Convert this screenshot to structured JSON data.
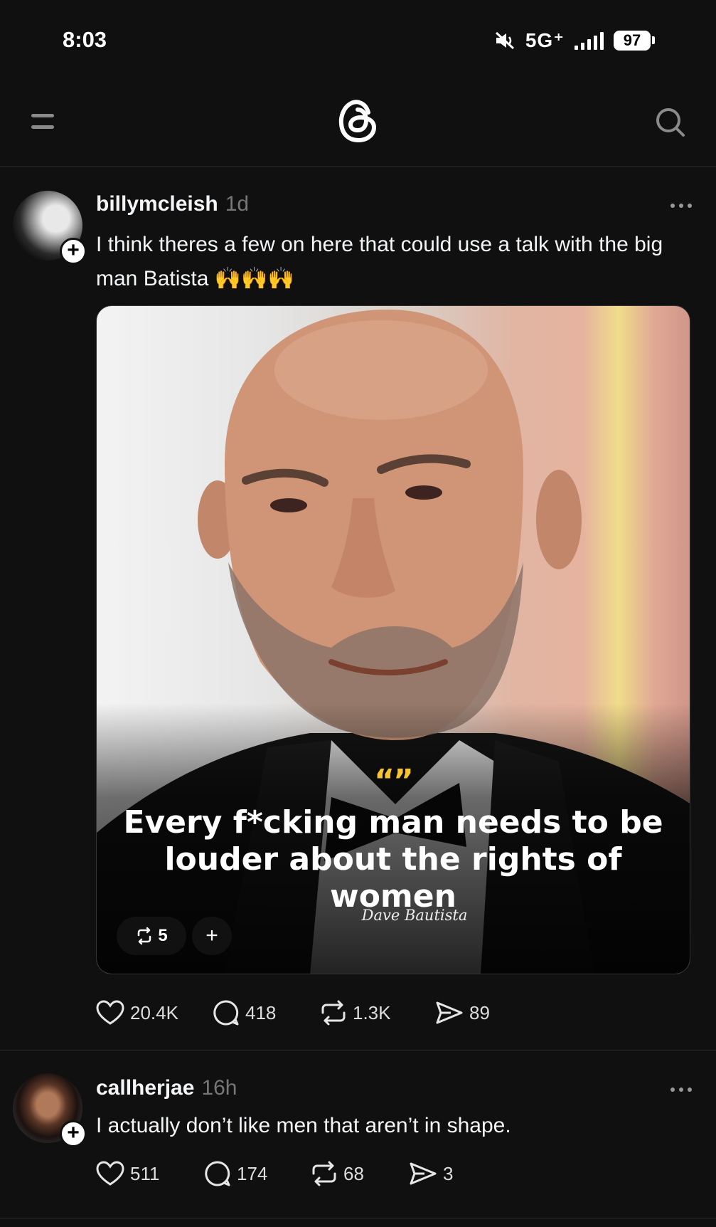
{
  "status_bar": {
    "time": "8:03",
    "network": "5G⁺",
    "battery": "97",
    "icons": [
      "mute-icon",
      "signal-icon",
      "battery-icon"
    ]
  },
  "top_nav": {
    "icons": [
      "menu-icon",
      "threads-logo-icon",
      "search-icon"
    ]
  },
  "posts": [
    {
      "username": "billymcleish",
      "time": "1d",
      "text": "I think theres a few on here that could use a talk with the big man Batista 🙌🙌🙌",
      "media": {
        "quote_mark": "“”",
        "quote": "Every f*cking man needs to be louder about the rights of women",
        "attribution": "Dave Bautista",
        "repost_count": "5"
      },
      "likes": "20.4K",
      "replies": "418",
      "reposts": "1.3K",
      "shares": "89"
    },
    {
      "username": "callherjae",
      "time": "16h",
      "text": "I actually don’t like men that aren’t in shape.",
      "likes": "511",
      "replies": "174",
      "reposts": "68",
      "shares": "3"
    }
  ],
  "colors": {
    "background": "#101010",
    "text": "#f3f5f7",
    "muted": "#777777",
    "quote_accent": "#f5c430"
  }
}
